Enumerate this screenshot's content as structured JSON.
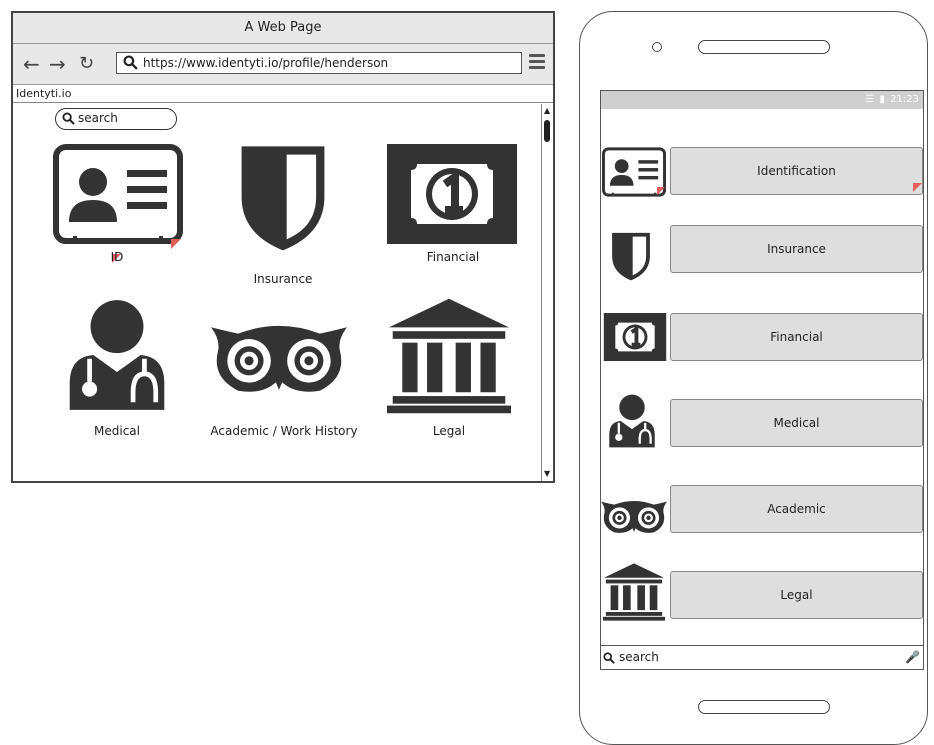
{
  "browser": {
    "window_title": "A Web Page",
    "url": "https://www.identyti.io/profile/henderson",
    "site_name": "Identyti.io",
    "search_placeholder": "search",
    "tiles": [
      {
        "label": "ID",
        "icon": "id-card-icon"
      },
      {
        "label": "Insurance",
        "icon": "shield-icon"
      },
      {
        "label": "Financial",
        "icon": "banknote-icon"
      },
      {
        "label": "Medical",
        "icon": "doctor-icon"
      },
      {
        "label": "Academic / Work History",
        "icon": "owl-eyes-icon"
      },
      {
        "label": "Legal",
        "icon": "courthouse-icon"
      }
    ]
  },
  "phone": {
    "status_time": "21:23",
    "items": [
      {
        "label": "Identification",
        "icon": "id-card-icon"
      },
      {
        "label": "Insurance",
        "icon": "shield-icon"
      },
      {
        "label": "Financial",
        "icon": "banknote-icon"
      },
      {
        "label": "Medical",
        "icon": "doctor-icon"
      },
      {
        "label": "Academic",
        "icon": "owl-eyes-icon"
      },
      {
        "label": "Legal",
        "icon": "courthouse-icon"
      }
    ],
    "search_placeholder": "search"
  },
  "colors": {
    "icon": "#333333",
    "button_bg": "#dedede",
    "cursor_accent": "#e06060"
  }
}
